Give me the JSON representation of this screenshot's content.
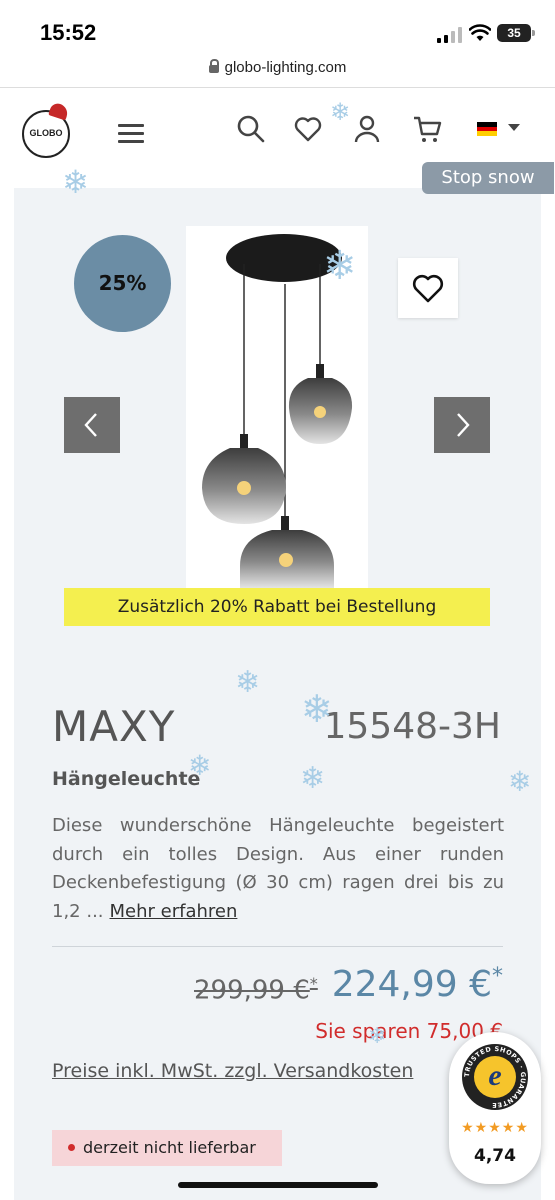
{
  "status_bar": {
    "time": "15:52",
    "battery": "35"
  },
  "browser": {
    "url": "globo-lighting.com"
  },
  "header": {
    "logo_text": "GLOBO",
    "icons": [
      "search-icon",
      "heart-icon",
      "user-icon",
      "cart-icon"
    ],
    "flag_colors": [
      "#000000",
      "#dd0000",
      "#ffce00"
    ],
    "stop_snow_label": "Stop snow"
  },
  "product": {
    "discount_badge": "25%",
    "promo_banner": "Zusätzlich 20% Rabatt bei Bestellung",
    "name": "MAXY",
    "sku": "15548-3H",
    "type": "Hängeleuchte",
    "description": "Diese wunderschöne Hängeleuchte begeistert durch ein tolles Design. Aus einer runden Deckenbefestigung (Ø 30 cm) ragen drei bis zu 1,2 ...",
    "more_link": "Mehr erfahren",
    "old_price": "299,99 €",
    "old_price_mark": "*",
    "new_price": "224,99 €",
    "new_price_mark": "*",
    "savings": "Sie sparen 75,00 €",
    "vat_note": "Preise inkl. MwSt. zzgl. Versandkosten",
    "availability": "derzeit nicht lieferbar"
  },
  "trusted_shops": {
    "seal_text": "TRUSTED SHOPS · GUARANTEE",
    "seal_letter": "e",
    "stars": "★★★★★",
    "rating": "4,74"
  },
  "colors": {
    "accent_price": "#5b87a6",
    "discount_badge": "#6b8da5",
    "promo_bg": "#f4ef4f",
    "savings_red": "#d12c2c",
    "card_bg": "#f0f3f6"
  }
}
